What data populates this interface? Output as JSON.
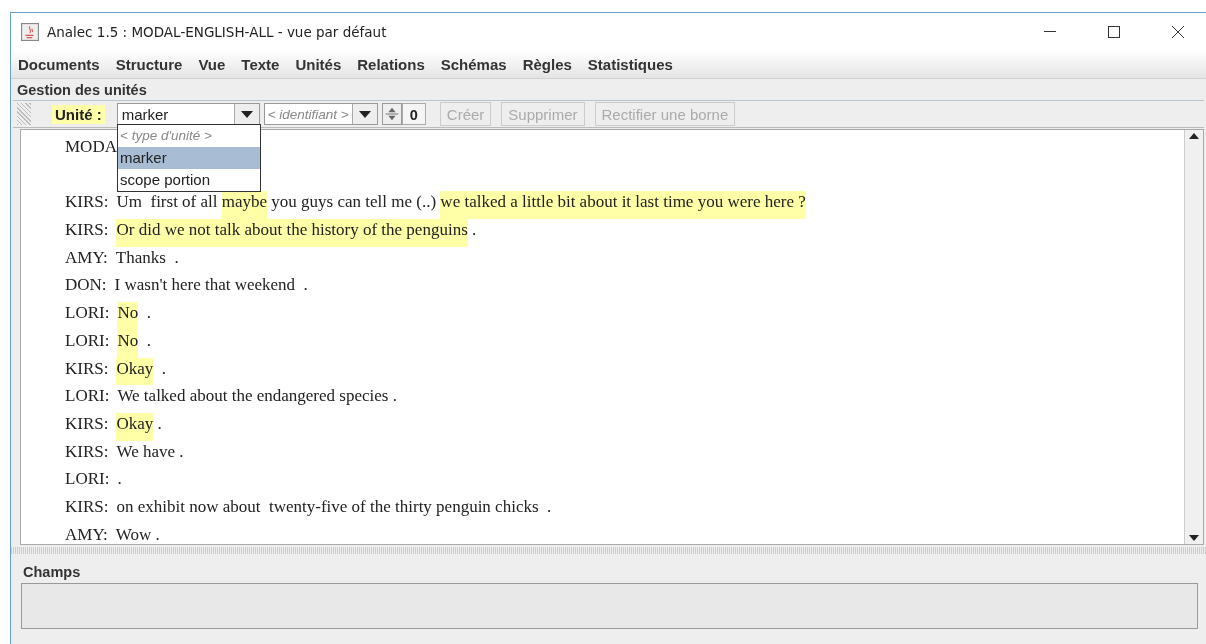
{
  "window": {
    "title": "Analec 1.5 : MODAL-ENGLISH-ALL - vue par défaut"
  },
  "menu": [
    "Documents",
    "Structure",
    "Vue",
    "Texte",
    "Unités",
    "Relations",
    "Schémas",
    "Règles",
    "Statistiques"
  ],
  "units_panel": {
    "title": "Gestion des unités",
    "unit_label": "Unité :",
    "unit_type": "marker",
    "identifier_placeholder": "< identifiant >",
    "count": "0",
    "buttons": [
      {
        "label": "Créer",
        "disabled": true
      },
      {
        "label": "Supprimer",
        "disabled": true
      },
      {
        "label": "Rectifier une borne",
        "disabled": true
      }
    ],
    "dropdown": [
      {
        "label": "< type d'unité >",
        "placeholder": true,
        "selected": false
      },
      {
        "label": "marker",
        "placeholder": false,
        "selected": true
      },
      {
        "label": "scope portion",
        "placeholder": false,
        "selected": false
      }
    ]
  },
  "transcript": [
    {
      "speaker": "MODA"
    },
    {
      "speaker": "KIRS:",
      "segments": [
        {
          "text": "Um  first of all ",
          "highlighted": false
        },
        {
          "text": "maybe",
          "highlighted": true
        },
        {
          "text": " you guys can tell me (..) ",
          "highlighted": false
        },
        {
          "text": "we talked a little bit about it last time you were here ?",
          "highlighted": true
        }
      ]
    },
    {
      "speaker": "KIRS:",
      "segments": [
        {
          "text": "Or did we not talk about the history of the penguins",
          "highlighted": true
        },
        {
          "text": " .",
          "highlighted": false
        }
      ]
    },
    {
      "speaker": "AMY:",
      "segments": [
        {
          "text": "Thanks  .",
          "highlighted": false
        }
      ]
    },
    {
      "speaker": "DON:",
      "segments": [
        {
          "text": "I wasn't here that weekend  .",
          "highlighted": false
        }
      ]
    },
    {
      "speaker": "LORI:",
      "segments": [
        {
          "text": "No",
          "highlighted": true
        },
        {
          "text": "  .",
          "highlighted": false
        }
      ]
    },
    {
      "speaker": "LORI:",
      "segments": [
        {
          "text": "No",
          "highlighted": true
        },
        {
          "text": "  .",
          "highlighted": false
        }
      ]
    },
    {
      "speaker": "KIRS:",
      "segments": [
        {
          "text": "Okay",
          "highlighted": true
        },
        {
          "text": "  .",
          "highlighted": false
        }
      ]
    },
    {
      "speaker": "LORI:",
      "segments": [
        {
          "text": "We talked about the endangered species .",
          "highlighted": false
        }
      ]
    },
    {
      "speaker": "KIRS:",
      "segments": [
        {
          "text": "Okay",
          "highlighted": true
        },
        {
          "text": " .",
          "highlighted": false
        }
      ]
    },
    {
      "speaker": "KIRS:",
      "segments": [
        {
          "text": "We have .",
          "highlighted": false
        }
      ]
    },
    {
      "speaker": "LORI:",
      "segments": [
        {
          "text": ".",
          "highlighted": false
        }
      ]
    },
    {
      "speaker": "KIRS:",
      "segments": [
        {
          "text": "on exhibit now about  twenty-five of the thirty penguin chicks  .",
          "highlighted": false
        }
      ]
    },
    {
      "speaker": "AMY:",
      "segments": [
        {
          "text": "Wow .",
          "highlighted": false
        }
      ]
    }
  ],
  "fields_panel": {
    "title": "Champs"
  }
}
